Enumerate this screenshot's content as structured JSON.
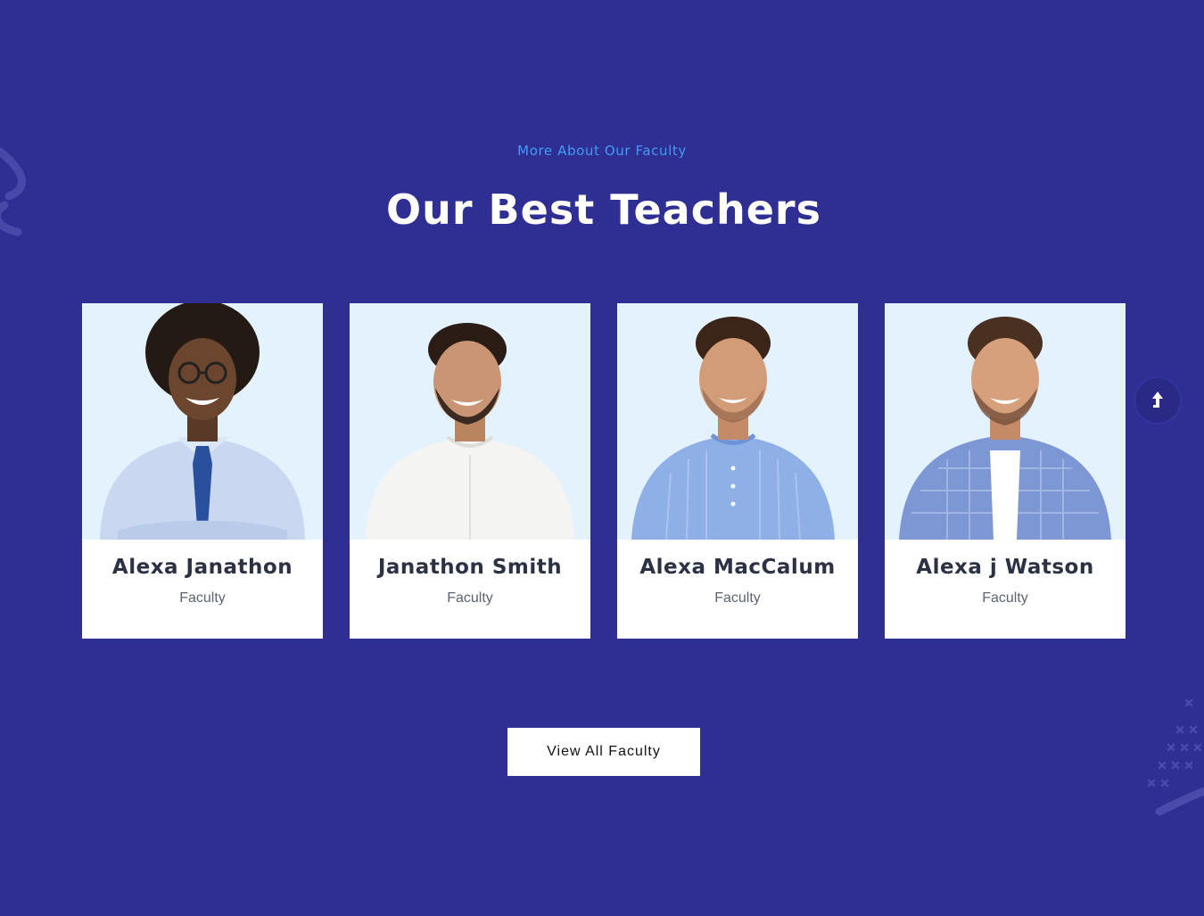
{
  "theme": {
    "background": "#2e2e93",
    "accent": "#3d9ef3",
    "card": "#ffffff",
    "photo_bg": "#e4f2fd"
  },
  "section": {
    "eyebrow": "More About Our Faculty",
    "title": "Our Best Teachers"
  },
  "teachers": [
    {
      "name": "Alexa Janathon",
      "role": "Faculty"
    },
    {
      "name": "Janathon Smith",
      "role": "Faculty"
    },
    {
      "name": "Alexa MacCalum",
      "role": "Faculty"
    },
    {
      "name": "Alexa j Watson",
      "role": "Faculty"
    }
  ],
  "cta": {
    "label": "View All Faculty"
  },
  "icons": {
    "scroll_top": "arrow-up-icon"
  }
}
